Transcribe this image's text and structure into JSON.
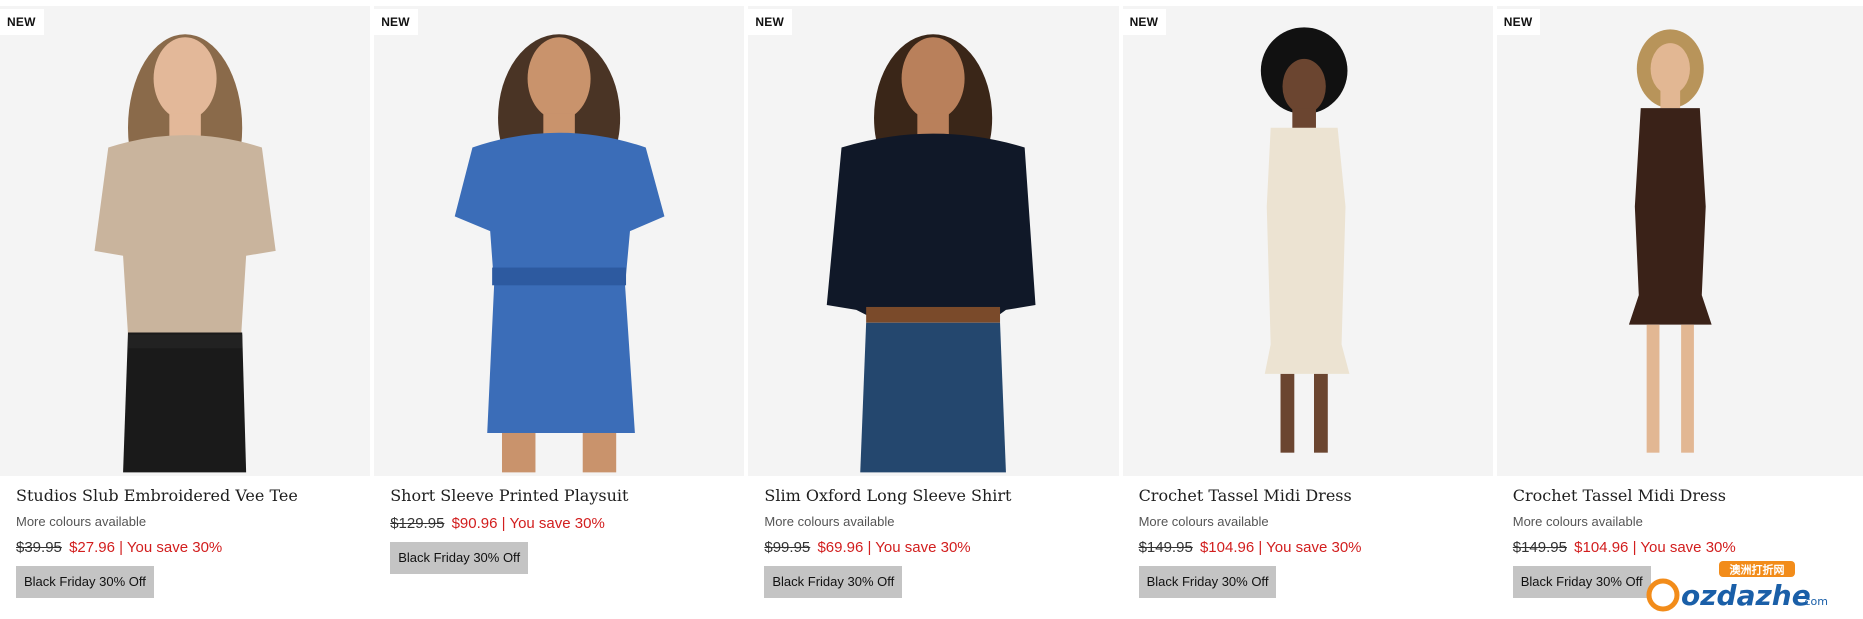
{
  "products": [
    {
      "badge": "NEW",
      "title": "Studios Slub Embroidered Vee Tee",
      "more_colours": "More colours available",
      "was_price": "$39.95",
      "now_price": "$27.96",
      "save_text": "| You save 30%",
      "promo": "Black Friday 30% Off",
      "garment_color": "#c9b49d",
      "bottom_color": "#1a1a1a",
      "hair_color": "#8a6a4a"
    },
    {
      "badge": "NEW",
      "title": "Short Sleeve Printed Playsuit",
      "more_colours": "",
      "was_price": "$129.95",
      "now_price": "$90.96",
      "save_text": "| You save 30%",
      "promo": "Black Friday 30% Off",
      "garment_color": "#3b6db8",
      "bottom_color": "#3b6db8",
      "hair_color": "#4a3425"
    },
    {
      "badge": "NEW",
      "title": "Slim Oxford Long Sleeve Shirt",
      "more_colours": "More colours available",
      "was_price": "$99.95",
      "now_price": "$69.96",
      "save_text": "| You save 30%",
      "promo": "Black Friday 30% Off",
      "garment_color": "#101828",
      "bottom_color": "#24476e",
      "hair_color": "#3a2618"
    },
    {
      "badge": "NEW",
      "title": "Crochet Tassel Midi Dress",
      "more_colours": "More colours available",
      "was_price": "$149.95",
      "now_price": "$104.96",
      "save_text": "| You save 30%",
      "promo": "Black Friday 30% Off",
      "garment_color": "#ece3d2",
      "bottom_color": "#ece3d2",
      "hair_color": "#111111"
    },
    {
      "badge": "NEW",
      "title": "Crochet Tassel Midi Dress",
      "more_colours": "More colours available",
      "was_price": "$149.95",
      "now_price": "$104.96",
      "save_text": "| You save 30%",
      "promo": "Black Friday 30% Off",
      "garment_color": "#3a2218",
      "bottom_color": "#3a2218",
      "hair_color": "#b8945a"
    }
  ],
  "watermark": {
    "brand": "ozdazhe",
    "suffix": ".com",
    "chinese": "澳洲打折网"
  }
}
